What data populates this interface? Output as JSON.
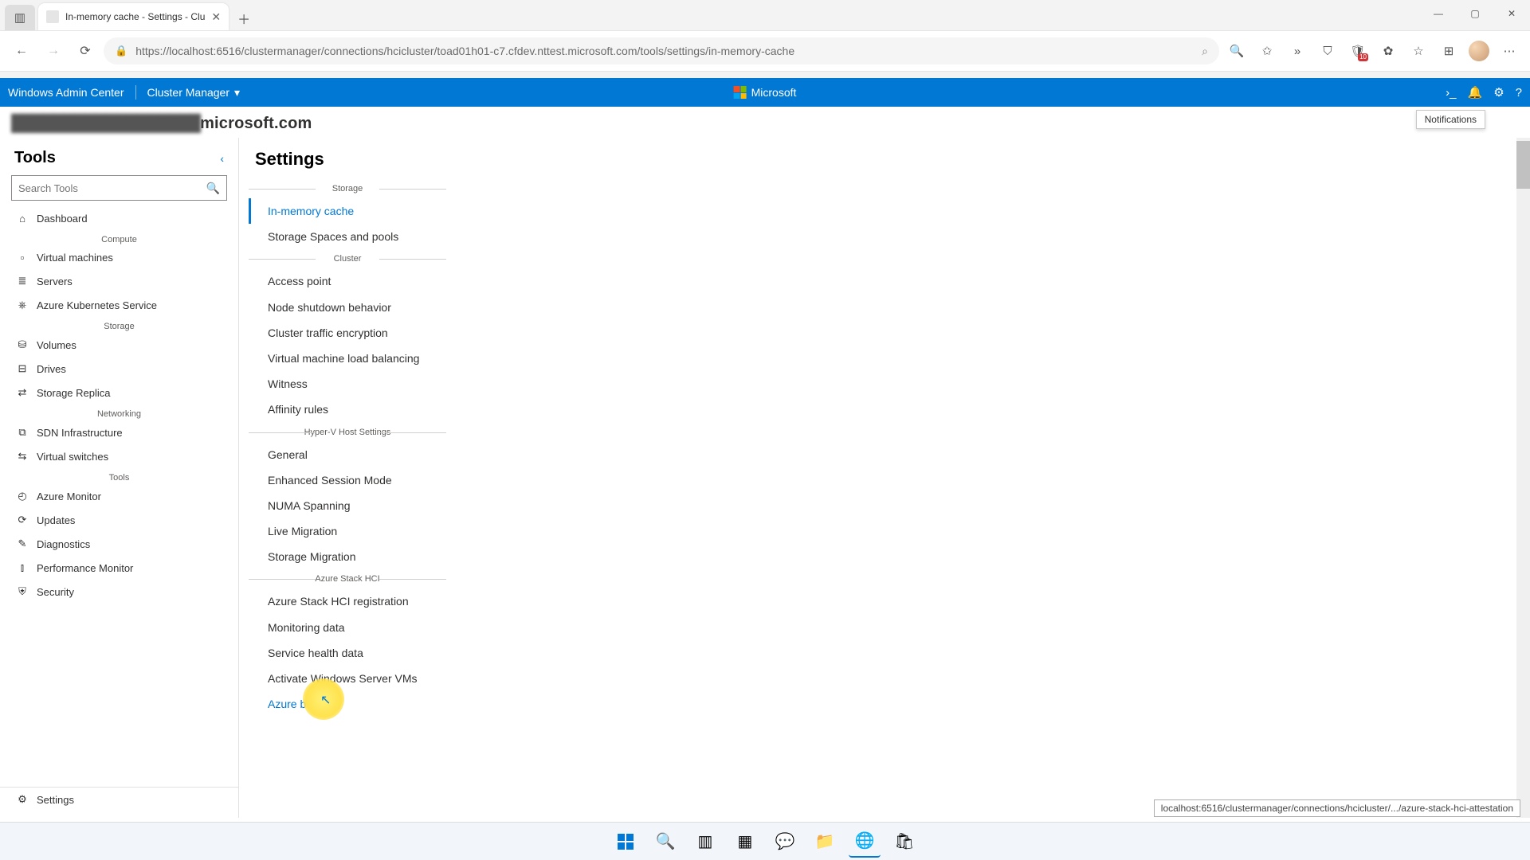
{
  "browser": {
    "tab_title": "In-memory cache - Settings - Clu",
    "url": "https://localhost:6516/clustermanager/connections/hcicluster/toad01h01-c7.cfdev.nttest.microsoft.com/tools/settings/in-memory-cache",
    "shield_badge": "10"
  },
  "wac": {
    "brand": "Windows Admin Center",
    "context": "Cluster Manager",
    "ms_label": "Microsoft",
    "notif_tooltip": "Notifications"
  },
  "breadcrumb": {
    "host_suffix": "microsoft.com"
  },
  "tools": {
    "title": "Tools",
    "search_placeholder": "Search Tools",
    "groups": [
      {
        "name": "",
        "items": [
          {
            "icon": "⌂",
            "label": "Dashboard"
          }
        ]
      },
      {
        "name": "Compute",
        "items": [
          {
            "icon": "▫",
            "label": "Virtual machines"
          },
          {
            "icon": "≣",
            "label": "Servers"
          },
          {
            "icon": "⎈",
            "label": "Azure Kubernetes Service"
          }
        ]
      },
      {
        "name": "Storage",
        "items": [
          {
            "icon": "⛁",
            "label": "Volumes"
          },
          {
            "icon": "⊟",
            "label": "Drives"
          },
          {
            "icon": "⇄",
            "label": "Storage Replica"
          }
        ]
      },
      {
        "name": "Networking",
        "items": [
          {
            "icon": "⧉",
            "label": "SDN Infrastructure"
          },
          {
            "icon": "⇆",
            "label": "Virtual switches"
          }
        ]
      },
      {
        "name": "Tools",
        "items": [
          {
            "icon": "◴",
            "label": "Azure Monitor"
          },
          {
            "icon": "⟳",
            "label": "Updates"
          },
          {
            "icon": "✎",
            "label": "Diagnostics"
          },
          {
            "icon": "⫾",
            "label": "Performance Monitor"
          },
          {
            "icon": "⛨",
            "label": "Security"
          }
        ]
      }
    ],
    "settings_label": "Settings"
  },
  "settings": {
    "title": "Settings",
    "groups": [
      {
        "name": "Storage",
        "items": [
          {
            "label": "In-memory cache",
            "active": true
          },
          {
            "label": "Storage Spaces and pools"
          }
        ]
      },
      {
        "name": "Cluster",
        "items": [
          {
            "label": "Access point"
          },
          {
            "label": "Node shutdown behavior"
          },
          {
            "label": "Cluster traffic encryption"
          },
          {
            "label": "Virtual machine load balancing"
          },
          {
            "label": "Witness"
          },
          {
            "label": "Affinity rules"
          }
        ]
      },
      {
        "name": "Hyper-V Host Settings",
        "items": [
          {
            "label": "General"
          },
          {
            "label": "Enhanced Session Mode"
          },
          {
            "label": "NUMA Spanning"
          },
          {
            "label": "Live Migration"
          },
          {
            "label": "Storage Migration"
          }
        ]
      },
      {
        "name": "Azure Stack HCI",
        "items": [
          {
            "label": "Azure Stack HCI registration"
          },
          {
            "label": "Monitoring data"
          },
          {
            "label": "Service health data"
          },
          {
            "label": "Activate Windows Server VMs"
          },
          {
            "label": "Azure benefits",
            "hover": true
          }
        ]
      }
    ]
  },
  "status_url": "localhost:6516/clustermanager/connections/hcicluster/.../azure-stack-hci-attestation"
}
